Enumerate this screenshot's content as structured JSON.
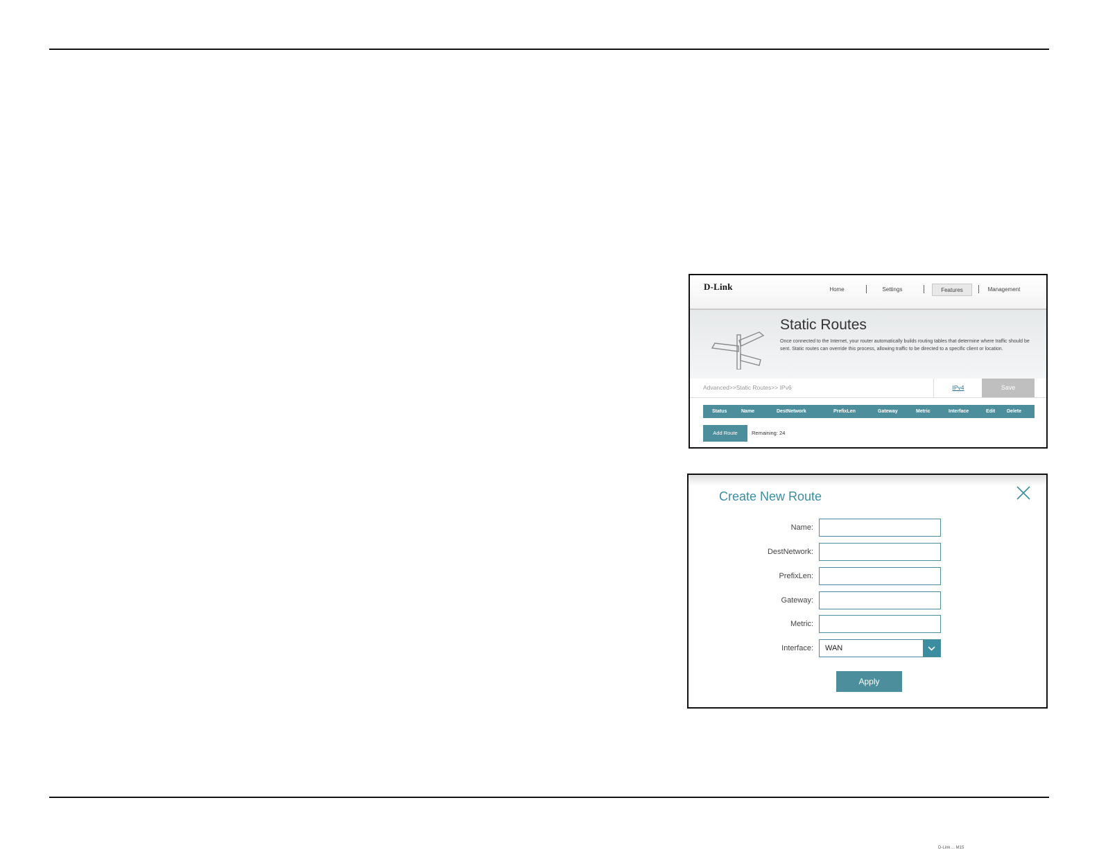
{
  "shot1": {
    "logo": "D-Link",
    "nav": {
      "home": "Home",
      "settings": "Settings",
      "features": "Features",
      "management": "Management"
    },
    "banner": {
      "title": "Static Routes",
      "description": "Once connected to the Internet, your router automatically builds routing tables that determine where traffic should be sent. Static routes can override this process, allowing traffic to be directed to a specific client or location."
    },
    "breadcrumb": "Advanced>>Static Routes>> IPv6",
    "ipv4_link": "IPv4",
    "save_label": "Save",
    "table_headers": [
      "Status",
      "Name",
      "DestNetwork",
      "PrefixLen",
      "Gateway",
      "Metric",
      "Interface",
      "Edit",
      "Delete"
    ],
    "add_route_label": "Add Route",
    "remaining": "Remaining: 24"
  },
  "shot2": {
    "title": "Create New Route",
    "fields": {
      "name_label": "Name:",
      "dest_label": "DestNetwork:",
      "prefix_label": "PrefixLen:",
      "gateway_label": "Gateway:",
      "metric_label": "Metric:",
      "interface_label": "Interface:",
      "interface_value": "WAN"
    },
    "apply_label": "Apply"
  },
  "accent_color": "#4c8e9c",
  "footer": "D-Link ... M15"
}
